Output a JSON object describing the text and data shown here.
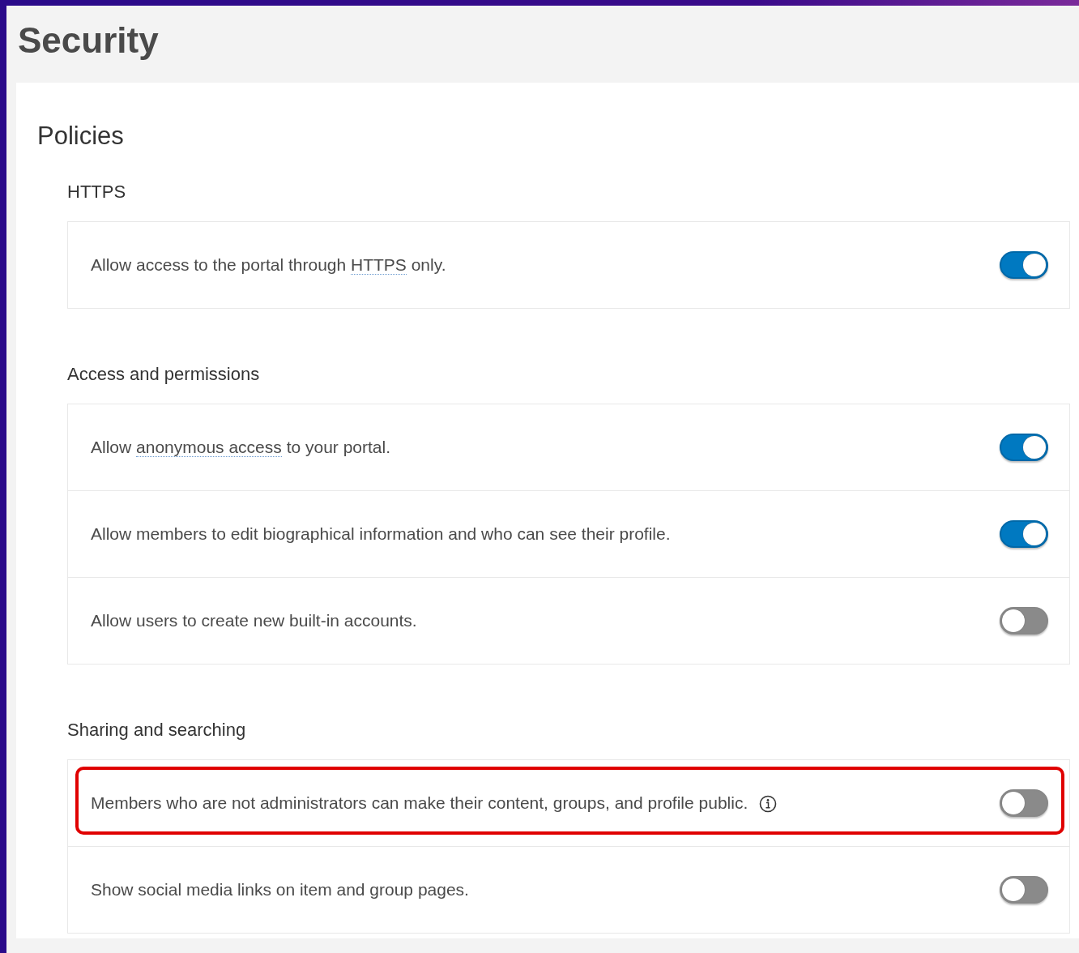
{
  "page_title": "Security",
  "panel": {
    "title": "Policies",
    "sections": [
      {
        "heading": "HTTPS",
        "items": [
          {
            "before": "Allow access to the portal through ",
            "term": "HTTPS",
            "after": " only.",
            "on": true,
            "highlighted": false,
            "info": false
          }
        ]
      },
      {
        "heading": "Access and permissions",
        "items": [
          {
            "before": "Allow ",
            "term": "anonymous access",
            "after": " to your portal.",
            "on": true,
            "highlighted": false,
            "info": false
          },
          {
            "before": "Allow members to edit biographical information and who can see their profile.",
            "on": true,
            "highlighted": false,
            "info": false
          },
          {
            "before": "Allow users to create new built-in accounts.",
            "on": false,
            "highlighted": false,
            "info": false
          }
        ]
      },
      {
        "heading": "Sharing and searching",
        "items": [
          {
            "before": "Members who are not administrators can make their content, groups, and profile public.",
            "on": false,
            "highlighted": true,
            "info": true
          },
          {
            "before": "Show social media links on item and group pages.",
            "on": false,
            "highlighted": false,
            "info": false
          }
        ]
      }
    ]
  }
}
